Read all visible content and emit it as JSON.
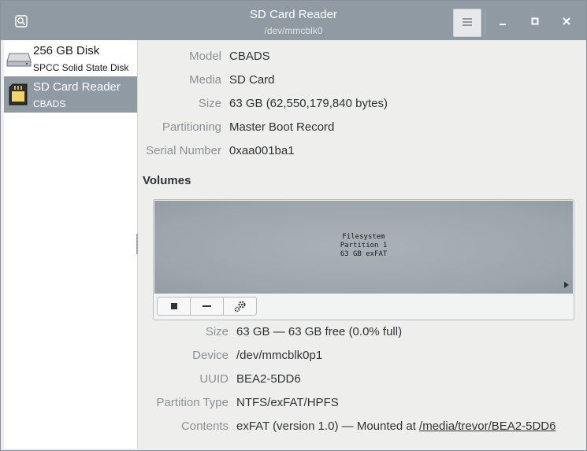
{
  "window": {
    "title": "SD Card Reader",
    "subtitle": "/dev/mmcblk0",
    "icons": {
      "app": "disks-app-icon",
      "menu": "hamburger-menu-icon",
      "minimize": "minimize-icon",
      "maximize": "maximize-icon",
      "close": "close-icon"
    }
  },
  "sidebar": {
    "items": [
      {
        "name": "256 GB Disk",
        "description": "SPCC Solid State Disk",
        "icon": "hard-disk-icon",
        "selected": false
      },
      {
        "name": "SD Card Reader",
        "description": "CBADS",
        "icon": "sd-card-icon",
        "selected": true
      }
    ]
  },
  "drive": {
    "model_label": "Model",
    "model": "CBADS",
    "media_label": "Media",
    "media": "SD Card",
    "size_label": "Size",
    "size": "63 GB (62,550,179,840 bytes)",
    "partitioning_label": "Partitioning",
    "partitioning": "Master Boot Record",
    "serial_label": "Serial Number",
    "serial": "0xaa001ba1"
  },
  "volumes": {
    "title": "Volumes",
    "partition": {
      "line1": "Filesystem",
      "line2": "Partition 1",
      "line3": "63 GB exFAT"
    },
    "toolbar": {
      "stop_icon": "stop-icon",
      "remove_icon": "minus-icon",
      "options_icon": "gears-icon"
    }
  },
  "partition_details": {
    "size_label": "Size",
    "size": "63 GB — 63 GB free (0.0% full)",
    "device_label": "Device",
    "device": "/dev/mmcblk0p1",
    "uuid_label": "UUID",
    "uuid": "BEA2-5DD6",
    "type_label": "Partition Type",
    "type": "NTFS/exFAT/HPFS",
    "contents_label": "Contents",
    "contents_prefix": "exFAT (version 1.0) — Mounted at ",
    "mount_point": "/media/trevor/BEA2-5DD6"
  },
  "colors": {
    "titlebar": "#8f9aa3",
    "selection": "#8f9aa3",
    "label": "#8b9196",
    "value": "#2e3436"
  }
}
